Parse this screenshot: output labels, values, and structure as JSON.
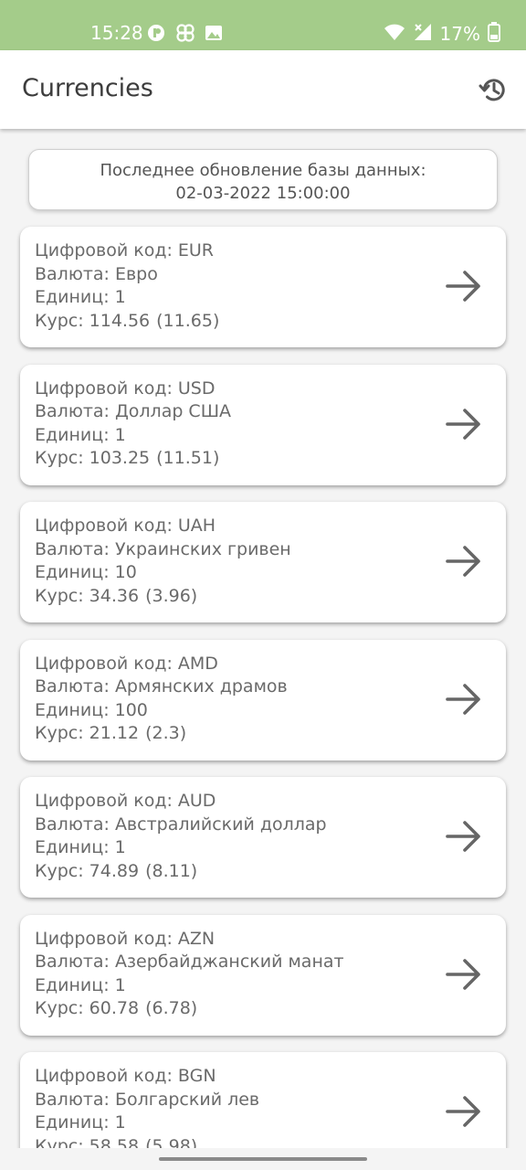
{
  "status_bar": {
    "time": "15:28",
    "battery": "17%",
    "icons_left": [
      "app-notification-icon",
      "pinwheel-icon",
      "image-icon"
    ],
    "icons_right": [
      "wifi-icon",
      "cell-signal-icon",
      "battery-icon"
    ]
  },
  "app_bar": {
    "title": "Currencies",
    "action_icon": "history-icon"
  },
  "update_info": {
    "label": "Последнее обновление базы данных:",
    "datetime": "02-03-2022 15:00:00"
  },
  "labels": {
    "code": "Цифровой код:",
    "currency": "Валюта:",
    "units": "Единиц:",
    "rate": "Курс:"
  },
  "currencies": [
    {
      "code": "EUR",
      "name": "Евро",
      "units": "1",
      "rate": "114.56",
      "change": "(11.65)"
    },
    {
      "code": "USD",
      "name": "Доллар США",
      "units": "1",
      "rate": "103.25",
      "change": "(11.51)"
    },
    {
      "code": "UAH",
      "name": "Украинских гривен",
      "units": "10",
      "rate": "34.36",
      "change": "(3.96)"
    },
    {
      "code": "AMD",
      "name": "Армянских драмов",
      "units": "100",
      "rate": "21.12",
      "change": "(2.3)"
    },
    {
      "code": "AUD",
      "name": "Австралийский доллар",
      "units": "1",
      "rate": "74.89",
      "change": "(8.11)"
    },
    {
      "code": "AZN",
      "name": "Азербайджанский манат",
      "units": "1",
      "rate": "60.78",
      "change": "(6.78)"
    },
    {
      "code": "BGN",
      "name": "Болгарский лев",
      "units": "1",
      "rate": "58.58",
      "change": "(5.98)"
    }
  ],
  "colors": {
    "status_bar": "#a4cc8a",
    "text": "#666666",
    "card_bg": "#ffffff"
  }
}
